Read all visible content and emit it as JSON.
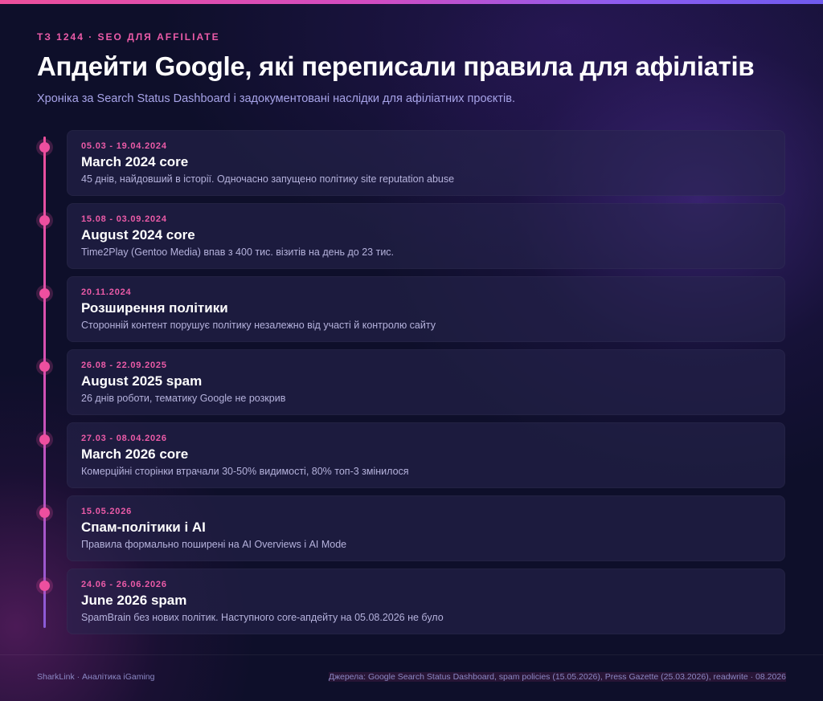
{
  "header": {
    "eyebrow": "ТЗ 1244 · SEO ДЛЯ AFFILIATE",
    "title": "Апдейти Google, які переписали правила для афіліатів",
    "subtitle": "Хроніка за Search Status Dashboard і задокументовані наслідки для афіліатних проєктів."
  },
  "timeline": [
    {
      "date": "05.03 - 19.04.2024",
      "title": "March 2024 core",
      "description": "45 днів, найдовший в історії. Одночасно запущено політику site reputation abuse"
    },
    {
      "date": "15.08 - 03.09.2024",
      "title": "August 2024 core",
      "description": "Time2Play (Gentoo Media) впав з 400 тис. візитів на день до 23 тис."
    },
    {
      "date": "20.11.2024",
      "title": "Розширення політики",
      "description": "Сторонній контент порушує політику незалежно від участі й контролю сайту"
    },
    {
      "date": "26.08 - 22.09.2025",
      "title": "August 2025 spam",
      "description": "26 днів роботи, тематику Google не розкрив"
    },
    {
      "date": "27.03 - 08.04.2026",
      "title": "March 2026 core",
      "description": "Комерційні сторінки втрачали 30-50% видимості, 80% топ-3 змінилося"
    },
    {
      "date": "15.05.2026",
      "title": "Спам-політики і AI",
      "description": "Правила формально поширені на AI Overviews і AI Mode"
    },
    {
      "date": "24.06 - 26.06.2026",
      "title": "June 2026 spam",
      "description": "SpamBrain без нових політик. Наступного core-апдейту на 05.08.2026 не було"
    }
  ],
  "footer": {
    "left": "SharkLink · Аналітика iGaming",
    "right": "Джерела: Google Search Status Dashboard, spam policies (15.05.2026), Press Gazette (25.03.2026), readwrite · 08.2026"
  },
  "colors": {
    "accent_pink": "#ec5ba8",
    "background": "#0e0f2a",
    "subtitle": "#a7a3e8"
  }
}
